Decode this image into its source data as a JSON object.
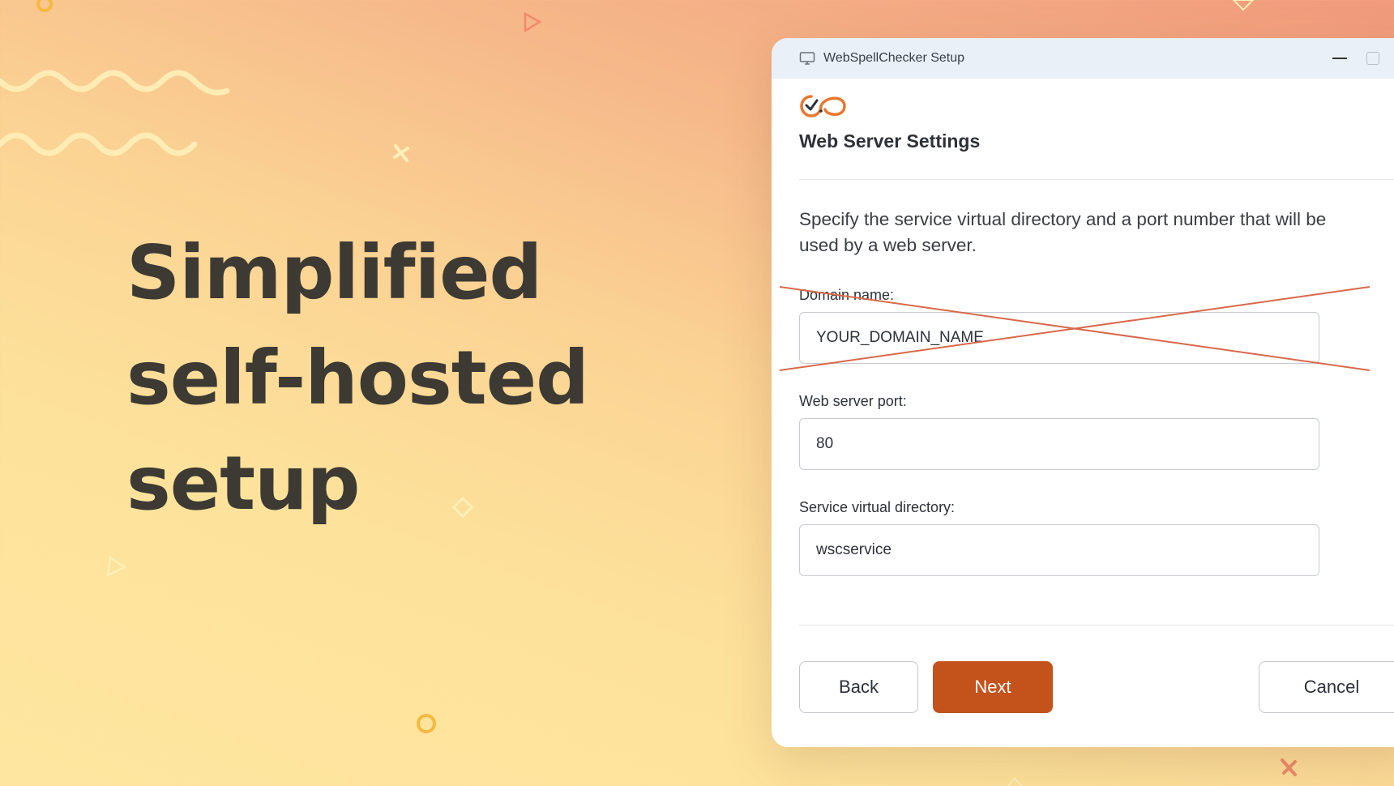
{
  "headline": {
    "line1": "Simplified",
    "line2": "self-hosted",
    "line3": "setup"
  },
  "window": {
    "title": "WebSpellChecker Setup",
    "app_icon": "monitor-icon",
    "controls": [
      "minimize-icon",
      "maximize-icon"
    ]
  },
  "page": {
    "logo": "webspellchecker-logo",
    "section_title": "Web Server Settings",
    "description": "Specify the service virtual directory and a port number that will be used by a web server."
  },
  "fields": {
    "domain_name": {
      "label": "Domain name:",
      "value": "YOUR_DOMAIN_NAME",
      "crossed_out": true
    },
    "web_server_port": {
      "label": "Web server port:",
      "value": "80"
    },
    "service_virtual_directory": {
      "label": "Service virtual directory:",
      "value": "wscservice"
    }
  },
  "buttons": {
    "back": "Back",
    "next": "Next",
    "cancel": "Cancel"
  },
  "colors": {
    "accent": "#c4521b",
    "logo_orange": "#e8772e",
    "cross_line": "#d8684a",
    "headline_text": "#3d3a33"
  }
}
